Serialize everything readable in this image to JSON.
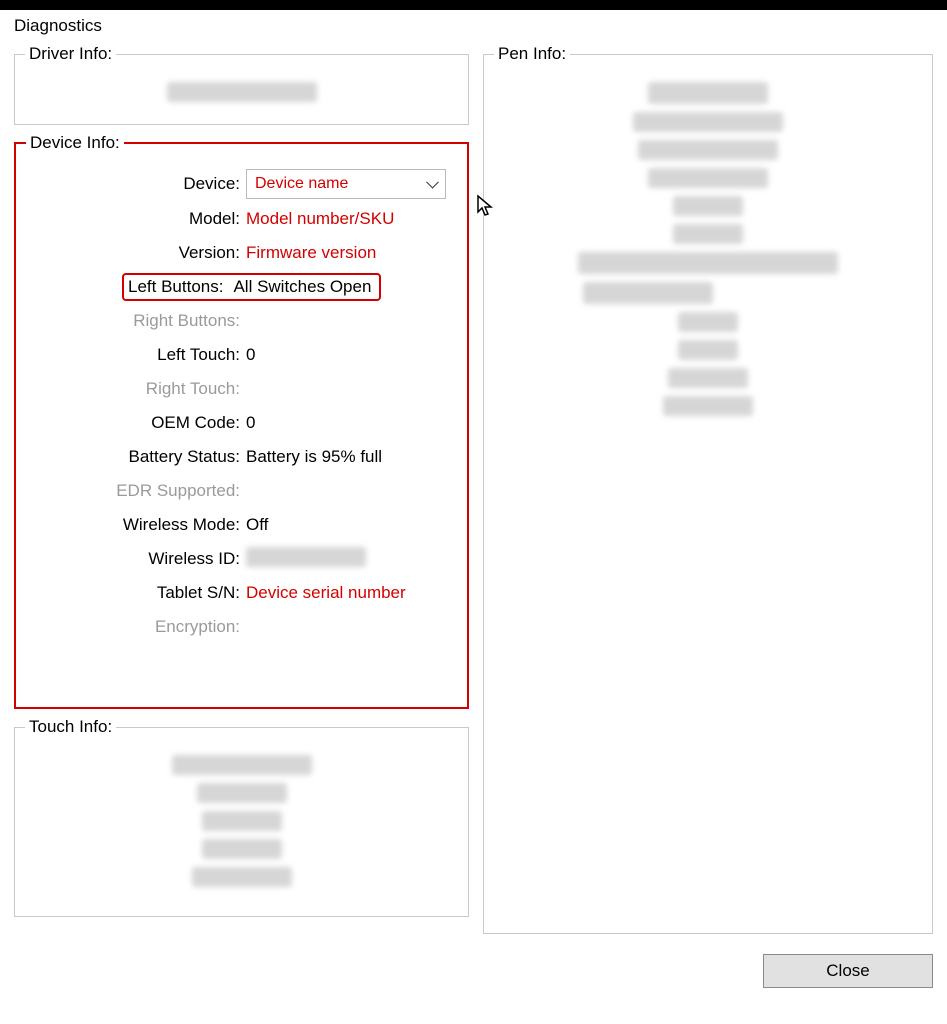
{
  "window": {
    "title": "Diagnostics"
  },
  "driver_info": {
    "legend": "Driver Info:"
  },
  "device_info": {
    "legend": "Device Info:",
    "device_label": "Device:",
    "device_value": "Device name",
    "model_label": "Model:",
    "model_value": "Model number/SKU",
    "version_label": "Version:",
    "version_value": "Firmware version",
    "left_buttons_label": "Left Buttons:",
    "left_buttons_value": "All Switches Open",
    "right_buttons_label": "Right Buttons:",
    "right_buttons_value": "",
    "left_touch_label": "Left Touch:",
    "left_touch_value": "0",
    "right_touch_label": "Right Touch:",
    "right_touch_value": "",
    "oem_code_label": "OEM Code:",
    "oem_code_value": "0",
    "battery_status_label": "Battery Status:",
    "battery_status_value": "Battery is 95% full",
    "edr_supported_label": "EDR Supported:",
    "edr_supported_value": "",
    "wireless_mode_label": "Wireless Mode:",
    "wireless_mode_value": "Off",
    "wireless_id_label": "Wireless ID:",
    "wireless_id_value": "",
    "tablet_sn_label": "Tablet S/N:",
    "tablet_sn_value": "Device serial number",
    "encryption_label": "Encryption:",
    "encryption_value": ""
  },
  "touch_info": {
    "legend": "Touch Info:"
  },
  "pen_info": {
    "legend": "Pen Info:"
  },
  "footer": {
    "close": "Close"
  }
}
